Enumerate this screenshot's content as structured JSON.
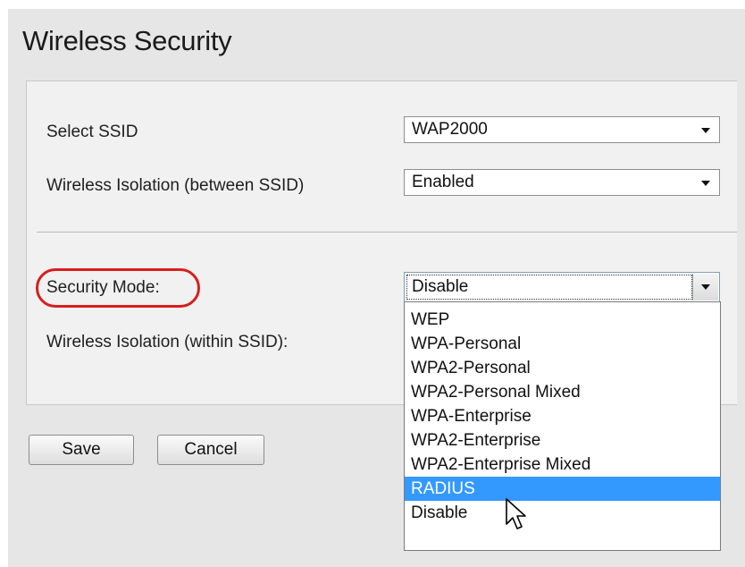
{
  "page": {
    "title": "Wireless Security"
  },
  "fields": {
    "select_ssid": {
      "label": "Select SSID",
      "value": "WAP2000"
    },
    "isolation_between": {
      "label": "Wireless Isolation (between SSID)",
      "value": "Enabled"
    },
    "security_mode": {
      "label": "Security Mode:",
      "value": "Disable"
    },
    "isolation_within": {
      "label": "Wireless Isolation (within SSID):"
    }
  },
  "dropdown": {
    "options": [
      "WEP",
      "WPA-Personal",
      "WPA2-Personal",
      "WPA2-Personal Mixed",
      "WPA-Enterprise",
      "WPA2-Enterprise",
      "WPA2-Enterprise Mixed",
      "RADIUS",
      "Disable"
    ],
    "highlighted": "RADIUS"
  },
  "buttons": {
    "save": "Save",
    "cancel": "Cancel"
  },
  "colors": {
    "highlight_ring": "#d81e1e",
    "selected_option": "#3399ff"
  }
}
